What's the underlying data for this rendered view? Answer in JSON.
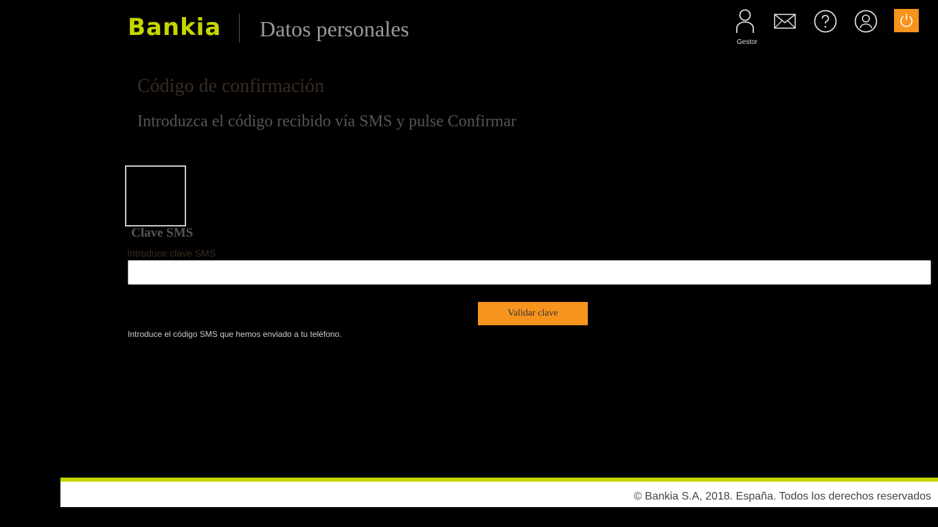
{
  "header": {
    "brand": "Bankia",
    "section_title": "Datos personales",
    "gestor_label": "Gestor",
    "icons": [
      "gestor-icon",
      "mail-icon",
      "help-icon",
      "profile-icon",
      "power-icon"
    ]
  },
  "main": {
    "heading": "Código de confirmación",
    "subheading": "Introduzca el código recibido vía SMS y pulse Confirmar",
    "clave_label": "Clave SMS",
    "input_label": "Introduce clave SMS",
    "input_value": "",
    "validate_button": "Validar clave",
    "help_text": "Introduce el código SMS que hemos enviado a tu teléfono."
  },
  "footer": {
    "copyright": "© Bankia S.A, 2018. España. Todos los derechos reservados"
  },
  "colors": {
    "brand_green": "#c4d600",
    "accent_orange": "#f7941d",
    "background": "#000000"
  }
}
